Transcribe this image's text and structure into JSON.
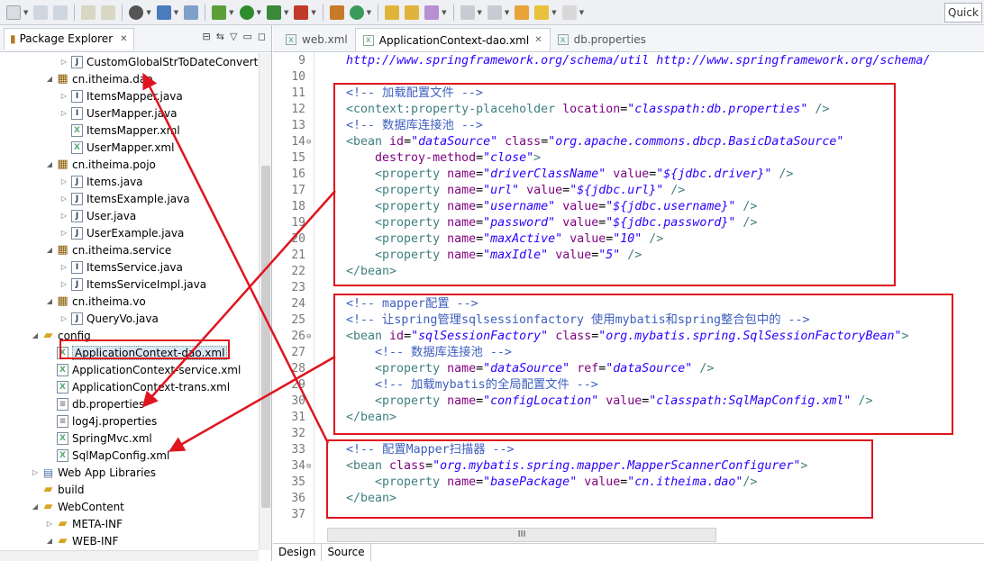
{
  "toolbar": {
    "quick_access": "Quick"
  },
  "package_explorer": {
    "title": "Package Explorer",
    "tree": [
      {
        "label": "CustomGlobalStrToDateConverte",
        "icon": "java-file-icon",
        "depth": 3,
        "twisty": "collapsed"
      },
      {
        "label": "cn.itheima.dao",
        "icon": "package-icon",
        "depth": 2,
        "twisty": "expanded"
      },
      {
        "label": "ItemsMapper.java",
        "icon": "java-interface-icon",
        "depth": 3,
        "twisty": "collapsed"
      },
      {
        "label": "UserMapper.java",
        "icon": "java-interface-icon",
        "depth": 3,
        "twisty": "collapsed"
      },
      {
        "label": "ItemsMapper.xml",
        "icon": "xml-file-icon",
        "depth": 3,
        "twisty": "none"
      },
      {
        "label": "UserMapper.xml",
        "icon": "xml-file-icon",
        "depth": 3,
        "twisty": "none"
      },
      {
        "label": "cn.itheima.pojo",
        "icon": "package-icon",
        "depth": 2,
        "twisty": "expanded"
      },
      {
        "label": "Items.java",
        "icon": "java-file-icon",
        "depth": 3,
        "twisty": "collapsed"
      },
      {
        "label": "ItemsExample.java",
        "icon": "java-file-icon",
        "depth": 3,
        "twisty": "collapsed"
      },
      {
        "label": "User.java",
        "icon": "java-file-icon",
        "depth": 3,
        "twisty": "collapsed"
      },
      {
        "label": "UserExample.java",
        "icon": "java-file-icon",
        "depth": 3,
        "twisty": "collapsed"
      },
      {
        "label": "cn.itheima.service",
        "icon": "package-icon",
        "depth": 2,
        "twisty": "expanded"
      },
      {
        "label": "ItemsService.java",
        "icon": "java-interface-icon",
        "depth": 3,
        "twisty": "collapsed"
      },
      {
        "label": "ItemsServiceImpl.java",
        "icon": "java-file-icon",
        "depth": 3,
        "twisty": "collapsed"
      },
      {
        "label": "cn.itheima.vo",
        "icon": "package-icon",
        "depth": 2,
        "twisty": "expanded"
      },
      {
        "label": "QueryVo.java",
        "icon": "java-file-icon",
        "depth": 3,
        "twisty": "collapsed"
      },
      {
        "label": "config",
        "icon": "source-folder-icon",
        "depth": 1,
        "twisty": "expanded"
      },
      {
        "label": "ApplicationContext-dao.xml",
        "icon": "xml-file-icon",
        "depth": 2,
        "twisty": "none",
        "selected": true
      },
      {
        "label": "ApplicationContext-service.xml",
        "icon": "xml-file-icon",
        "depth": 2,
        "twisty": "none"
      },
      {
        "label": "ApplicationContext-trans.xml",
        "icon": "xml-file-icon",
        "depth": 2,
        "twisty": "none"
      },
      {
        "label": "db.properties",
        "icon": "properties-file-icon",
        "depth": 2,
        "twisty": "none"
      },
      {
        "label": "log4j.properties",
        "icon": "properties-file-icon",
        "depth": 2,
        "twisty": "none"
      },
      {
        "label": "SpringMvc.xml",
        "icon": "xml-file-icon",
        "depth": 2,
        "twisty": "none"
      },
      {
        "label": "SqlMapConfig.xml",
        "icon": "xml-file-icon",
        "depth": 2,
        "twisty": "none"
      },
      {
        "label": "Web App Libraries",
        "icon": "library-icon",
        "depth": 1,
        "twisty": "collapsed"
      },
      {
        "label": "build",
        "icon": "folder-icon",
        "depth": 1,
        "twisty": "none"
      },
      {
        "label": "WebContent",
        "icon": "folder-icon",
        "depth": 1,
        "twisty": "expanded"
      },
      {
        "label": "META-INF",
        "icon": "folder-icon",
        "depth": 2,
        "twisty": "collapsed"
      },
      {
        "label": "WEB-INF",
        "icon": "folder-icon",
        "depth": 2,
        "twisty": "expanded"
      }
    ]
  },
  "editor": {
    "tabs": [
      {
        "label": "web.xml",
        "active": false,
        "closable": false
      },
      {
        "label": "ApplicationContext-dao.xml",
        "active": true,
        "closable": true
      },
      {
        "label": "db.properties",
        "active": false,
        "closable": false
      }
    ],
    "lines": [
      {
        "n": "9",
        "parts": [
          [
            "v",
            "http://www.springframework.org/schema/util http://www.springframework.org/schema/"
          ]
        ]
      },
      {
        "n": "10",
        "parts": []
      },
      {
        "n": "11",
        "parts": [
          [
            "c",
            "<!-- 加载配置文件 -->"
          ]
        ]
      },
      {
        "n": "12",
        "parts": [
          [
            "t",
            "<context:property-placeholder "
          ],
          [
            "a",
            "location"
          ],
          [
            "p",
            "="
          ],
          [
            "v",
            "\"classpath:db.properties\""
          ],
          [
            "t",
            " />"
          ]
        ]
      },
      {
        "n": "13",
        "parts": [
          [
            "c",
            "<!-- 数据库连接池 -->"
          ]
        ]
      },
      {
        "n": "14",
        "fold": true,
        "parts": [
          [
            "t",
            "<bean "
          ],
          [
            "a",
            "id"
          ],
          [
            "p",
            "="
          ],
          [
            "v",
            "\"dataSource\""
          ],
          [
            "a",
            " class"
          ],
          [
            "p",
            "="
          ],
          [
            "v",
            "\"org.apache.commons.dbcp.BasicDataSource\""
          ]
        ]
      },
      {
        "n": "15",
        "parts": [
          [
            "a",
            "    destroy-method"
          ],
          [
            "p",
            "="
          ],
          [
            "v",
            "\"close\""
          ],
          [
            "t",
            ">"
          ]
        ]
      },
      {
        "n": "16",
        "parts": [
          [
            "t",
            "    <property "
          ],
          [
            "a",
            "name"
          ],
          [
            "p",
            "="
          ],
          [
            "v",
            "\"driverClassName\""
          ],
          [
            "a",
            " value"
          ],
          [
            "p",
            "="
          ],
          [
            "v",
            "\"${jdbc.driver}\""
          ],
          [
            "t",
            " />"
          ]
        ]
      },
      {
        "n": "17",
        "parts": [
          [
            "t",
            "    <property "
          ],
          [
            "a",
            "name"
          ],
          [
            "p",
            "="
          ],
          [
            "v",
            "\"url\""
          ],
          [
            "a",
            " value"
          ],
          [
            "p",
            "="
          ],
          [
            "v",
            "\"${jdbc.url}\""
          ],
          [
            "t",
            " />"
          ]
        ]
      },
      {
        "n": "18",
        "parts": [
          [
            "t",
            "    <property "
          ],
          [
            "a",
            "name"
          ],
          [
            "p",
            "="
          ],
          [
            "v",
            "\"username\""
          ],
          [
            "a",
            " value"
          ],
          [
            "p",
            "="
          ],
          [
            "v",
            "\"${jdbc.username}\""
          ],
          [
            "t",
            " />"
          ]
        ]
      },
      {
        "n": "19",
        "parts": [
          [
            "t",
            "    <property "
          ],
          [
            "a",
            "name"
          ],
          [
            "p",
            "="
          ],
          [
            "v",
            "\"password\""
          ],
          [
            "a",
            " value"
          ],
          [
            "p",
            "="
          ],
          [
            "v",
            "\"${jdbc.password}\""
          ],
          [
            "t",
            " />"
          ]
        ]
      },
      {
        "n": "20",
        "parts": [
          [
            "t",
            "    <property "
          ],
          [
            "a",
            "name"
          ],
          [
            "p",
            "="
          ],
          [
            "v",
            "\"maxActive\""
          ],
          [
            "a",
            " value"
          ],
          [
            "p",
            "="
          ],
          [
            "v",
            "\"10\""
          ],
          [
            "t",
            " />"
          ]
        ]
      },
      {
        "n": "21",
        "parts": [
          [
            "t",
            "    <property "
          ],
          [
            "a",
            "name"
          ],
          [
            "p",
            "="
          ],
          [
            "v",
            "\"maxIdle\""
          ],
          [
            "a",
            " value"
          ],
          [
            "p",
            "="
          ],
          [
            "v",
            "\"5\""
          ],
          [
            "t",
            " />"
          ]
        ]
      },
      {
        "n": "22",
        "parts": [
          [
            "t",
            "</bean>"
          ]
        ]
      },
      {
        "n": "23",
        "parts": []
      },
      {
        "n": "24",
        "parts": [
          [
            "c",
            "<!-- mapper配置 -->"
          ]
        ]
      },
      {
        "n": "25",
        "parts": [
          [
            "c",
            "<!-- 让spring管理sqlsessionfactory 使用mybatis和spring整合包中的 -->"
          ]
        ]
      },
      {
        "n": "26",
        "fold": true,
        "parts": [
          [
            "t",
            "<bean "
          ],
          [
            "a",
            "id"
          ],
          [
            "p",
            "="
          ],
          [
            "v",
            "\"sqlSessionFactory\""
          ],
          [
            "a",
            " class"
          ],
          [
            "p",
            "="
          ],
          [
            "v",
            "\"org.mybatis.spring.SqlSessionFactoryBean\""
          ],
          [
            "t",
            ">"
          ]
        ]
      },
      {
        "n": "27",
        "parts": [
          [
            "c",
            "    <!-- 数据库连接池 -->"
          ]
        ]
      },
      {
        "n": "28",
        "parts": [
          [
            "t",
            "    <property "
          ],
          [
            "a",
            "name"
          ],
          [
            "p",
            "="
          ],
          [
            "v",
            "\"dataSource\""
          ],
          [
            "a",
            " ref"
          ],
          [
            "p",
            "="
          ],
          [
            "v",
            "\"dataSource\""
          ],
          [
            "t",
            " />"
          ]
        ]
      },
      {
        "n": "29",
        "parts": [
          [
            "c",
            "    <!-- 加载mybatis的全局配置文件 -->"
          ]
        ]
      },
      {
        "n": "30",
        "parts": [
          [
            "t",
            "    <property "
          ],
          [
            "a",
            "name"
          ],
          [
            "p",
            "="
          ],
          [
            "v",
            "\"configLocation\""
          ],
          [
            "a",
            " value"
          ],
          [
            "p",
            "="
          ],
          [
            "v",
            "\"classpath:SqlMapConfig.xml\""
          ],
          [
            "t",
            " />"
          ]
        ]
      },
      {
        "n": "31",
        "parts": [
          [
            "t",
            "</bean>"
          ]
        ]
      },
      {
        "n": "32",
        "parts": []
      },
      {
        "n": "33",
        "parts": [
          [
            "c",
            "<!-- 配置Mapper扫描器 -->"
          ]
        ]
      },
      {
        "n": "34",
        "fold": true,
        "parts": [
          [
            "t",
            "<bean "
          ],
          [
            "a",
            "class"
          ],
          [
            "p",
            "="
          ],
          [
            "v",
            "\"org.mybatis.spring.mapper.MapperScannerConfigurer\""
          ],
          [
            "t",
            ">"
          ]
        ]
      },
      {
        "n": "35",
        "parts": [
          [
            "t",
            "    <property "
          ],
          [
            "a",
            "name"
          ],
          [
            "p",
            "="
          ],
          [
            "v",
            "\"basePackage\""
          ],
          [
            "a",
            " value"
          ],
          [
            "p",
            "="
          ],
          [
            "v",
            "\"cn.itheima.dao\""
          ],
          [
            "t",
            "/>"
          ]
        ]
      },
      {
        "n": "36",
        "parts": [
          [
            "t",
            "</bean>"
          ]
        ]
      },
      {
        "n": "37",
        "parts": []
      }
    ],
    "bottom_tabs": [
      "Design",
      "Source"
    ],
    "hscroll_label": "III"
  },
  "annotation_color": "#e0141e"
}
